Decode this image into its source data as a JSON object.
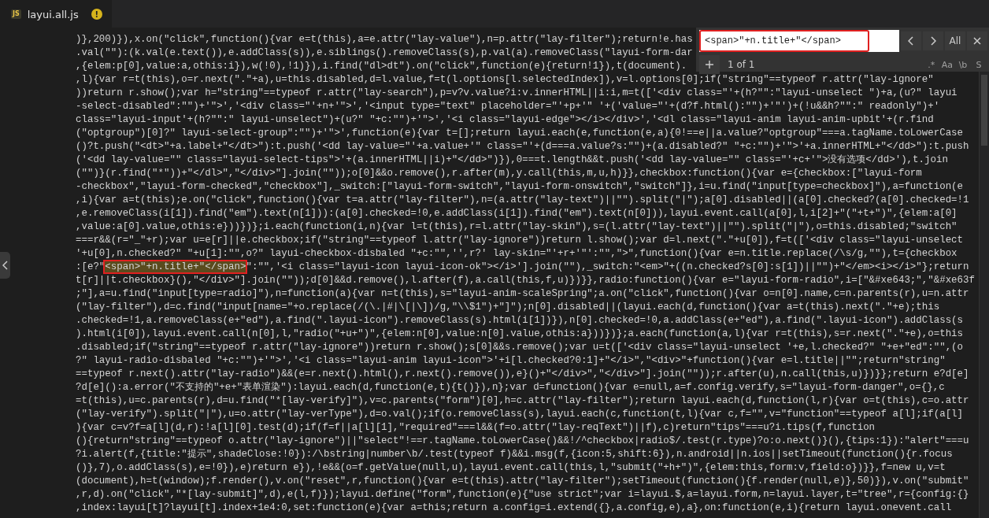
{
  "tab": {
    "badge": "JS",
    "filename": "layui.all.js",
    "warning": "!"
  },
  "find": {
    "query": "<span>\"+n.title+\"</span>",
    "query_highlighted": true,
    "all_button": "All",
    "count": "1 of 1",
    "options": [
      ".*",
      "Aa",
      "\\b",
      "S"
    ]
  },
  "code_lines": [
    {
      "kind": "plain",
      "text": ")},200)}),x.on(\"click\",function(){var e=t(this),a=e.attr(\"lay-value\"),n=p.attr(\"lay-filter\");return!e.has"
    },
    {
      "kind": "plain",
      "text": ".val(\"\"):(k.val(e.text()),e.addClass(s)),e.siblings().removeClass(s),p.val(a).removeClass(\"layui-form-dar"
    },
    {
      "kind": "plain",
      "text": ",{elem:p[0],value:a,othis:i}),w(!0),!1)}),i.find(\"dl>dt\").on(\"click\",function(e){return!1}),t(document)."
    },
    {
      "kind": "plain",
      "text": ",l){var r=t(this),o=r.next(\".\"+a),u=this.disabled,d=l.value,f=t(l.options[l.selectedIndex]),v=l.options[0];if(\"string\"==typeof r.attr(\"lay-ignore\""
    },
    {
      "kind": "plain",
      "text": "))return r.show();var h=\"string\"==typeof r.attr(\"lay-search\"),p=v?v.value?i:v.innerHTML||i:i,m=t(['<div class=\"'+(h?\"\":\"layui-unselect \")+a,(u?\" layui"
    },
    {
      "kind": "plain",
      "text": "-select-disabled\":\"\")+'\">','<div class=\"'+n+'\">','<input type=\"text\" placeholder=\"'+p+'\" '+('value=\"'+(d?f.html():\"\")+'\"')+(!u&&h?\"\":\" readonly\")+'"
    },
    {
      "kind": "plain",
      "text": "class=\"layui-input'+(h?\"\":\" layui-unselect\")+(u?\" \"+c:\"\")+'\">','<i class=\"layui-edge\"></i></div>','<dl class=\"layui-anim layui-anim-upbit'+(r.find"
    },
    {
      "kind": "plain",
      "text": "(\"optgroup\")[0]?\" layui-select-group\":\"\")+'\">',function(e){var t=[];return layui.each(e,function(e,a){0!==e||a.value?\"optgroup\"===a.tagName.toLowerCase"
    },
    {
      "kind": "plain",
      "text": "()?t.push(\"<dt>\"+a.label+\"</dt>\"):t.push('<dd lay-value=\"'+a.value+'\" class=\"'+(d===a.value?s:\"\")+(a.disabled?\" \"+c:\"\")+'\">'+a.innerHTML+\"</dd>\"):t.push"
    },
    {
      "kind": "plain",
      "text": "('<dd lay-value=\"\" class=\"layui-select-tips\">'+(a.innerHTML||i)+\"</dd>\")}),0===t.length&&t.push('<dd lay-value=\"\" class=\"'+c+'\">没有选项</dd>'),t.join"
    },
    {
      "kind": "plain",
      "text": "(\"\")}(r.find(\"*\"))+\"</dl>\",\"</div>\"].join(\"\"));o[0]&&o.remove(),r.after(m),y.call(this,m,u,h)}},checkbox:function(){var e={checkbox:[\"layui-form"
    },
    {
      "kind": "plain",
      "text": "-checkbox\",\"layui-form-checked\",\"checkbox\"],_switch:[\"layui-form-switch\",\"layui-form-onswitch\",\"switch\"]},i=u.find(\"input[type=checkbox]\"),a=function(e"
    },
    {
      "kind": "plain",
      "text": ",i){var a=t(this);e.on(\"click\",function(){var t=a.attr(\"lay-filter\"),n=(a.attr(\"lay-text\")||\"\").split(\"|\");a[0].disabled||(a[0].checked?(a[0].checked=!1"
    },
    {
      "kind": "plain",
      "text": ",e.removeClass(i[1]).find(\"em\").text(n[1])):(a[0].checked=!0,e.addClass(i[1]).find(\"em\").text(n[0])),layui.event.call(a[0],l,i[2]+\"(\"+t+\")\",{elem:a[0]"
    },
    {
      "kind": "plain",
      "text": ",value:a[0].value,othis:e}))})};i.each(function(i,n){var l=t(this),r=l.attr(\"lay-skin\"),s=(l.attr(\"lay-text\")||\"\").split(\"|\"),o=this.disabled;\"switch\""
    },
    {
      "kind": "plain",
      "text": "===r&&(r=\"_\"+r);var u=e[r]||e.checkbox;if(\"string\"==typeof l.attr(\"lay-ignore\"))return l.show();var d=l.next(\".\"+u[0]),f=t(['<div class=\"layui-unselect"
    },
    {
      "kind": "plain",
      "text": "'+u[0],n.checked?\" \"+u[1]:\"\",o?\" layui-checkbox-disbaled \"+c:\"\",'',r?' lay-skin=\"'+r+'\"':\"\",\">\",function(){var e=n.title.replace(/\\s/g,\"\"),t={checkbox"
    },
    {
      "kind": "match",
      "before": ":[e?\"",
      "match": "<span>\"+n.title+\"</span>",
      "after": "\":\"\",'<i class=\"layui-icon layui-icon-ok\"></i>'].join(\"\"),_switch:\"<em>\"+((n.checked?s[0]:s[1])||\"\")+\"</em><i></i>\"};return",
      "highlighted": true
    },
    {
      "kind": "plain",
      "text": "t[r]||t.checkbox}(),\"</div>\"].join(\"\"));d[0]&&d.remove(),l.after(f),a.call(this,f,u)})}},radio:function(){var e=\"layui-form-radio\",i=[\"&#xe643;\",\"&#xe63f"
    },
    {
      "kind": "plain",
      "text": ";\"],a=u.find(\"input[type=radio]\"),n=function(a){var n=t(this),s=\"layui-anim-scaleSpring\";a.on(\"click\",function(){var o=n[0].name,c=n.parents(r),u=n.attr"
    },
    {
      "kind": "plain",
      "text": "(\"lay-filter\"),d=c.find(\"input[name=\"+o.replace(/(\\.|#|\\[|\\])/g,\"\\\\$1\")+\"]\");n[0].disabled||(layui.each(d,function(){var a=t(this).next(\".\"+e);this"
    },
    {
      "kind": "plain",
      "text": ".checked=!1,a.removeClass(e+\"ed\"),a.find(\".layui-icon\").removeClass(s).html(i[1])}),n[0].checked=!0,a.addClass(e+\"ed\"),a.find(\".layui-icon\").addClass(s"
    },
    {
      "kind": "plain",
      "text": ").html(i[0]),layui.event.call(n[0],l,\"radio(\"+u+\")\",{elem:n[0],value:n[0].value,othis:a}))})};a.each(function(a,l){var r=t(this),s=r.next(\".\"+e),o=this"
    },
    {
      "kind": "plain",
      "text": ".disabled;if(\"string\"==typeof r.attr(\"lay-ignore\"))return r.show();s[0]&&s.remove();var u=t(['<div class=\"layui-unselect '+e,l.checked?\" \"+e+\"ed\":\"\",(o"
    },
    {
      "kind": "plain",
      "text": "?\" layui-radio-disbaled \"+c:\"\")+'\">','<i class=\"layui-anim layui-icon\">'+i[l.checked?0:1]+\"</i>\",\"<div>\"+function(){var e=l.title||\"\";return\"string\""
    },
    {
      "kind": "plain",
      "text": "==typeof r.next().attr(\"lay-radio\")&&(e=r.next().html(),r.next().remove()),e}()+\"</div>\",\"</div>\"].join(\"\"));r.after(u),n.call(this,u)})}};return e?d[e]"
    },
    {
      "kind": "plain",
      "text": "?d[e]():a.error(\"不支持的\"+e+\"表单渲染\"):layui.each(d,function(e,t){t()}),n};var d=function(){var e=null,a=f.config.verify,s=\"layui-form-danger\",o={},c"
    },
    {
      "kind": "plain",
      "text": "=t(this),u=c.parents(r),d=u.find(\"*[lay-verify]\"),v=c.parents(\"form\")[0],h=c.attr(\"lay-filter\");return layui.each(d,function(l,r){var o=t(this),c=o.attr"
    },
    {
      "kind": "plain",
      "text": "(\"lay-verify\").split(\"|\"),u=o.attr(\"lay-verType\"),d=o.val();if(o.removeClass(s),layui.each(c,function(t,l){var c,f=\"\",v=\"function\"==typeof a[l];if(a[l]"
    },
    {
      "kind": "plain",
      "text": "){var c=v?f=a[l](d,r):!a[l][0].test(d);if(f=f||a[l][1],\"required\"===l&&(f=o.attr(\"lay-reqText\")||f),c)return\"tips\"===u?i.tips(f,function"
    },
    {
      "kind": "plain",
      "text": "(){return\"string\"==typeof o.attr(\"lay-ignore\")||\"select\"!==r.tagName.toLowerCase()&&!/^checkbox|radio$/.test(r.type)?o:o.next()}(),{tips:1}):\"alert\"===u"
    },
    {
      "kind": "plain",
      "text": "?i.alert(f,{title:\"提示\",shadeClose:!0}):/\\bstring|number\\b/.test(typeof f)&&i.msg(f,{icon:5,shift:6}),n.android||n.ios||setTimeout(function(){r.focus"
    },
    {
      "kind": "plain",
      "text": "()},7),o.addClass(s),e=!0}),e)return e}),!e&&(o=f.getValue(null,u),layui.event.call(this,l,\"submit(\"+h+\")\",{elem:this,form:v,field:o})}},f=new u,v=t"
    },
    {
      "kind": "plain",
      "text": "(document),h=t(window);f.render(),v.on(\"reset\",r,function(){var e=t(this).attr(\"lay-filter\");setTimeout(function(){f.render(null,e)},50)}),v.on(\"submit\""
    },
    {
      "kind": "plain",
      "text": ",r,d).on(\"click\",\"*[lay-submit]\",d),e(l,f)});layui.define(\"form\",function(e){\"use strict\";var i=layui.$,a=layui.form,n=layui.layer,t=\"tree\",r={config:{}"
    },
    {
      "kind": "plain",
      "text": ",index:layui[t]?layui[t].index+1e4:0,set:function(e){var a=this;return a.config=i.extend({},a.config,e),a},on:function(e,i){return layui.onevent.call"
    }
  ]
}
